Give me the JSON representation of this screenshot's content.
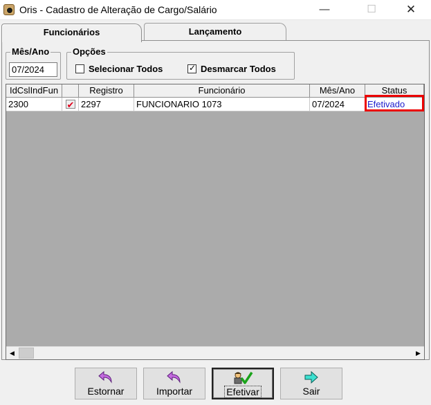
{
  "window": {
    "title": "Oris - Cadastro de Alteração de Cargo/Salário",
    "minimize_glyph": "—",
    "maximize_glyph": "☐",
    "close_glyph": "✕"
  },
  "tabs": [
    {
      "label": "Funcionários",
      "active": true
    },
    {
      "label": "Lançamento",
      "active": false
    }
  ],
  "filters": {
    "month_group_title": "Mês/Ano",
    "month_value": "07/2024",
    "options_group_title": "Opções",
    "select_all_label": "Selecionar Todos",
    "select_all_checked": false,
    "unselect_all_label": "Desmarcar Todos",
    "unselect_all_checked": true
  },
  "grid": {
    "columns": [
      "IdCslIndFun",
      "",
      "Registro",
      "Funcionário",
      "Mês/Ano",
      "Status"
    ],
    "rows": [
      {
        "id": "2300",
        "checked": true,
        "registro": "2297",
        "funcionario": "FUNCIONARIO 1073",
        "mes_ano": "07/2024",
        "status": "Efetivado"
      }
    ],
    "status_color": "#1b1bcc",
    "highlight_color": "#ec0000"
  },
  "scrollbar": {
    "left_arrow": "◀",
    "right_arrow": "▶"
  },
  "buttons": {
    "estornar": "Estornar",
    "importar": "Importar",
    "efetivar": "Efetivar",
    "sair": "Sair"
  },
  "icons": {
    "estornar": "purple-curved-arrow-icon",
    "importar": "purple-curved-arrow-icon",
    "efetivar": "person-checkmark-icon",
    "sair": "teal-right-arrow-icon"
  }
}
